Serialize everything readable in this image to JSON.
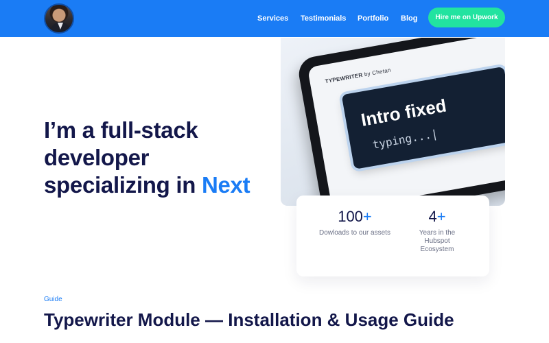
{
  "header": {
    "nav": [
      "Services",
      "Testimonials",
      "Portfolio",
      "Blog"
    ],
    "cta_label": "Hire me on Upwork",
    "colors": {
      "bar": "#1a7cf5",
      "cta": "#22e3a0"
    }
  },
  "hero": {
    "heading_main": "I’m a full-stack developer specializing in",
    "heading_accent": "Next",
    "image": {
      "brand_name": "TYPEWRITER",
      "brand_by": "by Chetan",
      "title_text": "Intro fixed",
      "typing_text": "typing...|"
    }
  },
  "stats": [
    {
      "value": "100",
      "suffix": "+",
      "label": "Dowloads to our assets"
    },
    {
      "value": "4",
      "suffix": "+",
      "label": "Years in the Hubspot Ecosystem"
    }
  ],
  "guide": {
    "eyebrow": "Guide",
    "title": "Typewriter Module — Installation & Usage Guide"
  }
}
